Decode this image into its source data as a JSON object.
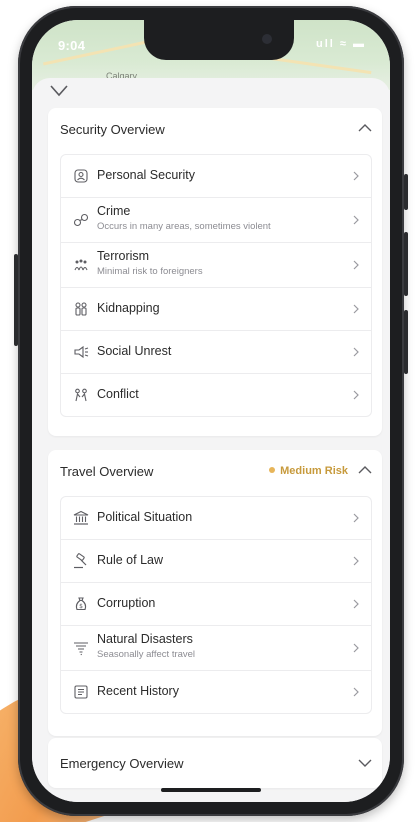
{
  "status_bar": {
    "time": "9:04",
    "icons": "ull ≈ ▬"
  },
  "map": {
    "label": "Calgary"
  },
  "security": {
    "title": "Security Overview",
    "items": [
      {
        "label": "Personal Security",
        "sub": "",
        "icon": "person-shield-icon"
      },
      {
        "label": "Crime",
        "sub": "Occurs in many areas, sometimes violent",
        "icon": "handcuffs-icon"
      },
      {
        "label": "Terrorism",
        "sub": "Minimal risk to foreigners",
        "icon": "crowd-icon"
      },
      {
        "label": "Kidnapping",
        "sub": "",
        "icon": "hostage-icon"
      },
      {
        "label": "Social Unrest",
        "sub": "",
        "icon": "megaphone-icon"
      },
      {
        "label": "Conflict",
        "sub": "",
        "icon": "conflict-icon"
      }
    ]
  },
  "travel": {
    "title": "Travel Overview",
    "risk_label": "Medium Risk",
    "risk_color": "#e7b55a",
    "items": [
      {
        "label": "Political Situation",
        "sub": "",
        "icon": "government-building-icon"
      },
      {
        "label": "Rule of Law",
        "sub": "",
        "icon": "gavel-icon"
      },
      {
        "label": "Corruption",
        "sub": "",
        "icon": "money-bag-icon"
      },
      {
        "label": "Natural Disasters",
        "sub": "Seasonally affect travel",
        "icon": "tornado-icon"
      },
      {
        "label": "Recent History",
        "sub": "",
        "icon": "history-book-icon"
      }
    ]
  },
  "emergency": {
    "title": "Emergency Overview"
  }
}
